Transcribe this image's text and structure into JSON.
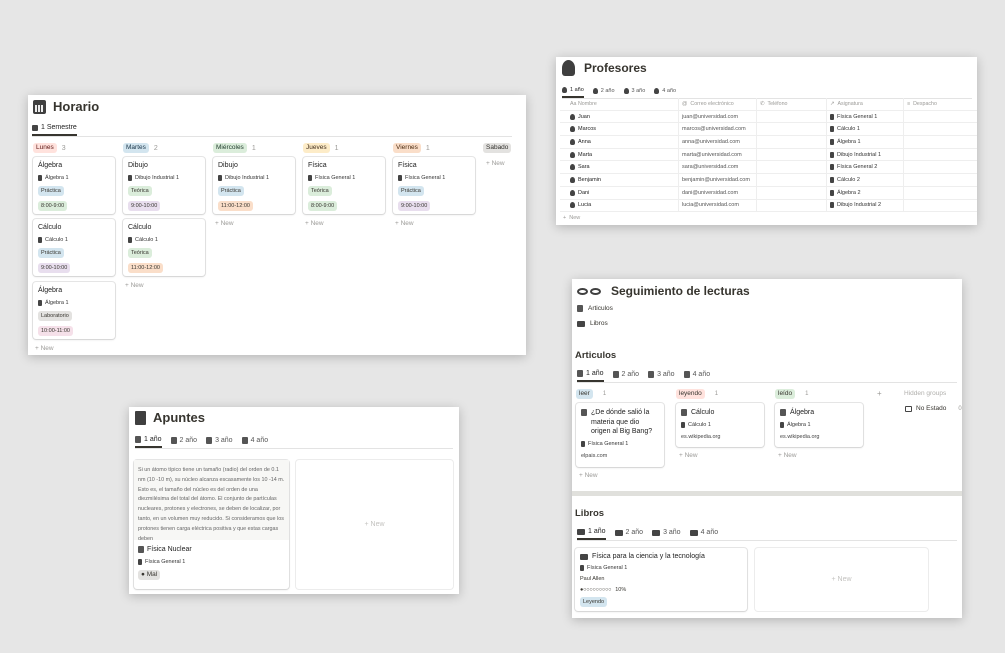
{
  "horario": {
    "title": "Horario",
    "tab": "1 Semestre",
    "new_label": "New",
    "columns": [
      {
        "name": "Lunes",
        "count": "3",
        "color": "#ffe2dd",
        "text_color": "#5d1715"
      },
      {
        "name": "Martes",
        "count": "2",
        "color": "#d3e5ef",
        "text_color": "#183347"
      },
      {
        "name": "Miércoles",
        "count": "1",
        "color": "#dbeddb",
        "text_color": "#1c3829"
      },
      {
        "name": "Jueves",
        "count": "1",
        "color": "#fdecc8",
        "text_color": "#402c1b"
      },
      {
        "name": "Viernes",
        "count": "1",
        "color": "#fadec9",
        "text_color": "#49290e"
      },
      {
        "name": "Sabado",
        "count": "",
        "color": "#e3e2e0",
        "text_color": "#32302c"
      }
    ],
    "cards": [
      {
        "title": "Álgebra",
        "subject": "Álgebra 1",
        "type": "Práctica",
        "time": "8:00-9:00"
      },
      {
        "title": "Cálculo",
        "subject": "Cálculo 1",
        "type": "Práctica",
        "time": "9:00-10:00"
      },
      {
        "title": "Álgebra",
        "subject": "Álgebra 1",
        "type": "Laboratorio",
        "time": "10:00-11:00"
      },
      {
        "title": "Dibujo",
        "subject": "Dibujo Industrial 1",
        "type": "Teórica",
        "time": "9:00-10:00"
      },
      {
        "title": "Cálculo",
        "subject": "Cálculo 1",
        "type": "Teórica",
        "time": "11:00-12:00"
      },
      {
        "title": "Dibujo",
        "subject": "Dibujo Industrial 1",
        "type": "Práctica",
        "time": "11:00-12:00"
      },
      {
        "title": "Física",
        "subject": "Física General 1",
        "type": "Teórica",
        "time": "8:00-9:00"
      },
      {
        "title": "Física",
        "subject": "Física General 1",
        "type": "Práctica",
        "time": "9:00-10:00"
      }
    ]
  },
  "profesores": {
    "title": "Profesores",
    "tabs": [
      "1 año",
      "2 año",
      "3 año",
      "4 año"
    ],
    "headers": [
      "Aa Nombre",
      "Correo electrónico",
      "Teléfono",
      "Asignatura",
      "Despacho"
    ],
    "rows": [
      {
        "name": "Juan",
        "email": "juan@universidad.com",
        "subject": "Física General 1"
      },
      {
        "name": "Marcos",
        "email": "marcos@universidad.com",
        "subject": "Cálculo 1"
      },
      {
        "name": "Anna",
        "email": "anna@universidad.com",
        "subject": "Álgebra 1"
      },
      {
        "name": "Marta",
        "email": "marta@universidad.com",
        "subject": "Dibujo Industrial 1"
      },
      {
        "name": "Sara",
        "email": "sara@universidad.com",
        "subject": "Física General 2"
      },
      {
        "name": "Benjamin",
        "email": "benjamin@universidad.com",
        "subject": "Cálculo 2"
      },
      {
        "name": "Dani",
        "email": "dani@universidad.com",
        "subject": "Álgebra 2"
      },
      {
        "name": "Lucia",
        "email": "lucia@universidad.com",
        "subject": "Dibujo Industrial 2"
      }
    ],
    "new_label": "New"
  },
  "apuntes": {
    "title": "Apuntes",
    "tabs": [
      "1 año",
      "2 año",
      "3 año",
      "4 año"
    ],
    "preview_text": "Si un átomo típico tiene un tamaño (radio) del orden de 0.1 nm (10 -10 m), su núcleo alcanza escasamente los 10 -14 m. Esto es, el tamaño del núcleo es del orden de una diezmilésima del total del átomo. El conjunto de partículas nucleares, protones y electrones, se deben de localizar, por tanto, en un volumen muy reducido. Si consideramos que los protones tienen carga eléctrica positiva y que estas cargas deben",
    "card_title": "Física Nuclear",
    "card_subject": "Física General 1",
    "card_tag": "Mal",
    "new_label": "New"
  },
  "lecturas": {
    "title": "Seguimiento de lecturas",
    "links": [
      "Articulos",
      "Libros"
    ],
    "articulos_heading": "Articulos",
    "articulos_tabs": [
      "1 año",
      "2 año",
      "3 año",
      "4 año"
    ],
    "groups": [
      {
        "name": "leer",
        "count": "1",
        "color": "#d3e5ef"
      },
      {
        "name": "leyendo",
        "count": "1",
        "color": "#ffe2dd"
      },
      {
        "name": "leído",
        "count": "1",
        "color": "#dbeddb"
      }
    ],
    "hidden_groups": "Hidden groups",
    "no_estado": "No Estado",
    "no_estado_count": "0",
    "articles": [
      {
        "title": "¿De dónde salió la materia que dio origen al Big Bang?",
        "subject": "Física General 1",
        "source": "elpais.com"
      },
      {
        "title": "Cálculo",
        "subject": "Cálculo 1",
        "source": "es.wikipedia.org"
      },
      {
        "title": "Álgebra",
        "subject": "Álgebra 1",
        "source": "es.wikipedia.org"
      }
    ],
    "libros_heading": "Libros",
    "libros_tabs": [
      "1 año",
      "2 año",
      "3 año",
      "4 año"
    ],
    "book": {
      "title": "Física para la ciencia y la tecnología",
      "subject": "Física General 1",
      "author": "Paul Allen",
      "progress_text": "10%",
      "progress": 0.1,
      "status": "Leyendo"
    },
    "new_label": "New"
  }
}
